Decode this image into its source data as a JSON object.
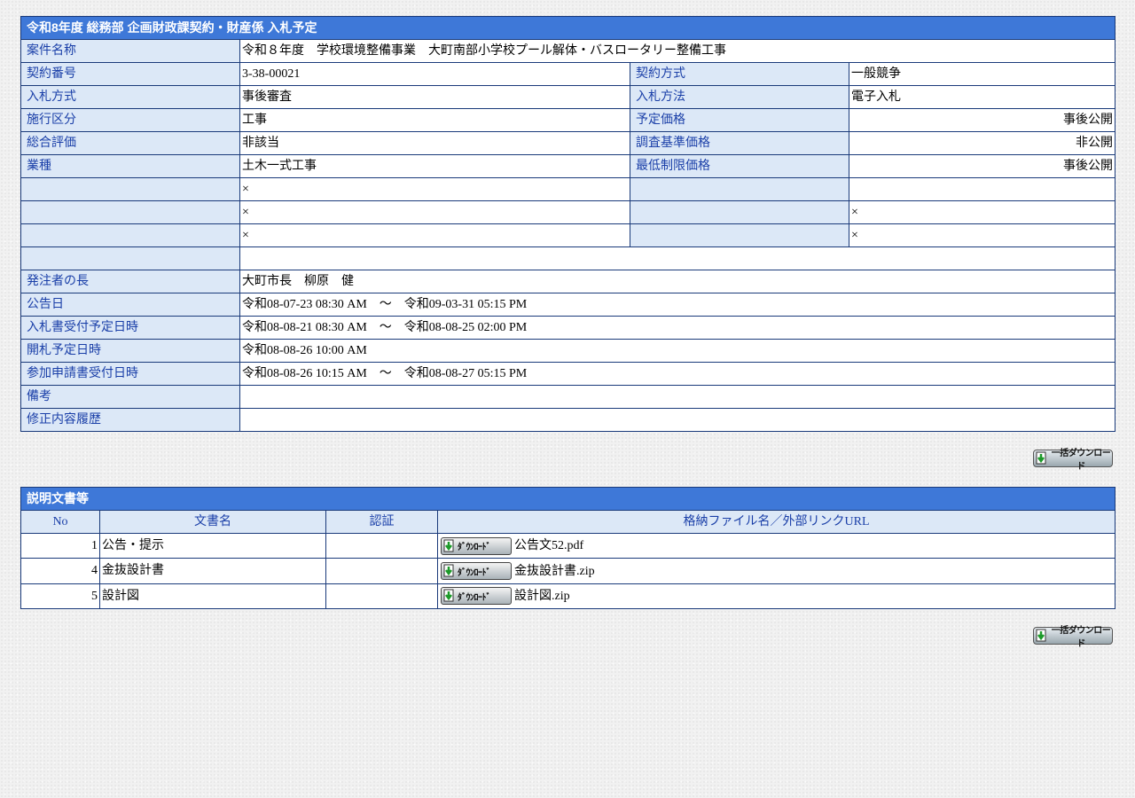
{
  "header": {
    "title": "令和8年度 総務部 企画財政課契約・財産係 入札予定"
  },
  "project_name": {
    "label": "案件名称",
    "value": "令和８年度　学校環境整備事業　大町南部小学校プール解体・バスロータリー整備工事"
  },
  "pair_rows": [
    {
      "l1": "契約番号",
      "v1": "3-38-00021",
      "l2": "契約方式",
      "v2": "一般競争",
      "v2_align": "left"
    },
    {
      "l1": "入札方式",
      "v1": "事後審査",
      "l2": "入札方法",
      "v2": "電子入札",
      "v2_align": "left"
    },
    {
      "l1": "施行区分",
      "v1": "工事",
      "l2": "予定価格",
      "v2": "事後公開",
      "v2_align": "right"
    },
    {
      "l1": "総合評価",
      "v1": "非該当",
      "l2": "調査基準価格",
      "v2": "非公開",
      "v2_align": "right"
    },
    {
      "l1": "業種",
      "v1": "土木一式工事",
      "l2": "最低制限価格",
      "v2": "事後公開",
      "v2_align": "right"
    },
    {
      "l1": "",
      "v1": "×",
      "l2": "",
      "v2": "",
      "v2_align": "left"
    },
    {
      "l1": "",
      "v1": "×",
      "l2": "",
      "v2": "×",
      "v2_align": "left"
    },
    {
      "l1": "",
      "v1": "×",
      "l2": "",
      "v2": "×",
      "v2_align": "left"
    }
  ],
  "full_rows": [
    {
      "label": "",
      "value": ""
    },
    {
      "label": "発注者の長",
      "value": "大町市長　柳原　健"
    },
    {
      "label": "公告日",
      "value": "令和08-07-23 08:30 AM　～　令和09-03-31 05:15 PM"
    },
    {
      "label": "入札書受付予定日時",
      "value": "令和08-08-21 08:30 AM　～　令和08-08-25 02:00 PM"
    },
    {
      "label": "開札予定日時",
      "value": "令和08-08-26 10:00 AM"
    },
    {
      "label": "参加申請書受付日時",
      "value": "令和08-08-26 10:15 AM　～　令和08-08-27 05:15 PM"
    },
    {
      "label": "備考",
      "value": ""
    },
    {
      "label": "修正内容履歴",
      "value": ""
    }
  ],
  "bulk_download_label": "一括ダウンロード",
  "documents": {
    "title": "説明文書等",
    "columns": [
      "No",
      "文書名",
      "認証",
      "格納ファイル名／外部リンクURL"
    ],
    "download_label": "ﾀﾞｳﾝﾛｰﾄﾞ",
    "rows": [
      {
        "no": "1",
        "name": "公告・提示",
        "auth": "",
        "file": "公告文52.pdf"
      },
      {
        "no": "4",
        "name": "金抜設計書",
        "auth": "",
        "file": "金抜設計書.zip"
      },
      {
        "no": "5",
        "name": "設計図",
        "auth": "",
        "file": "設計図.zip"
      }
    ]
  },
  "colors": {
    "header_bg": "#3e78d8",
    "label_bg": "#dce8f7",
    "label_text": "#1a3fa8",
    "border": "#1a3a7a"
  }
}
